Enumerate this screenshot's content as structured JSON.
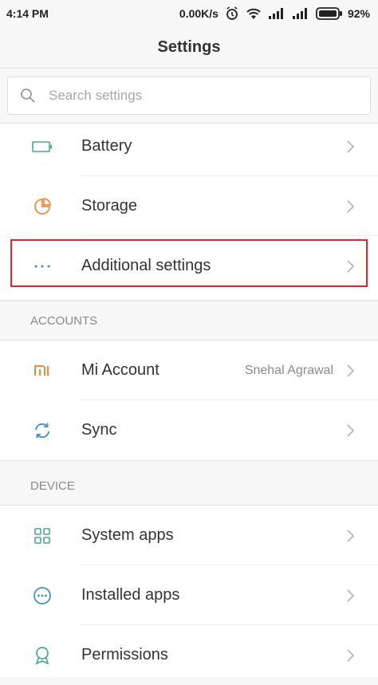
{
  "status_bar": {
    "time": "4:14 PM",
    "net_speed": "0.00K/s",
    "battery_pct": "92%"
  },
  "header": {
    "title": "Settings"
  },
  "search": {
    "placeholder": "Search settings",
    "value": ""
  },
  "sections": {
    "accounts_header": "ACCOUNTS",
    "device_header": "DEVICE"
  },
  "items": {
    "battery": {
      "label": "Battery",
      "icon": "battery-icon"
    },
    "storage": {
      "label": "Storage",
      "icon": "storage-pie-icon"
    },
    "additional": {
      "label": "Additional settings",
      "icon": "more-dots-icon"
    },
    "mi_account": {
      "label": "Mi Account",
      "value": "Snehal Agrawal",
      "icon": "mi-logo-icon"
    },
    "sync": {
      "label": "Sync",
      "icon": "sync-icon"
    },
    "system_apps": {
      "label": "System apps",
      "icon": "grid-icon"
    },
    "installed_apps": {
      "label": "Installed apps",
      "icon": "apps-circle-icon"
    },
    "permissions": {
      "label": "Permissions",
      "icon": "badge-icon"
    }
  },
  "colors": {
    "accent_green": "#4aa88a",
    "accent_orange": "#f08a3c",
    "accent_blue": "#3a8fc4",
    "highlight_red": "#e0262b"
  }
}
